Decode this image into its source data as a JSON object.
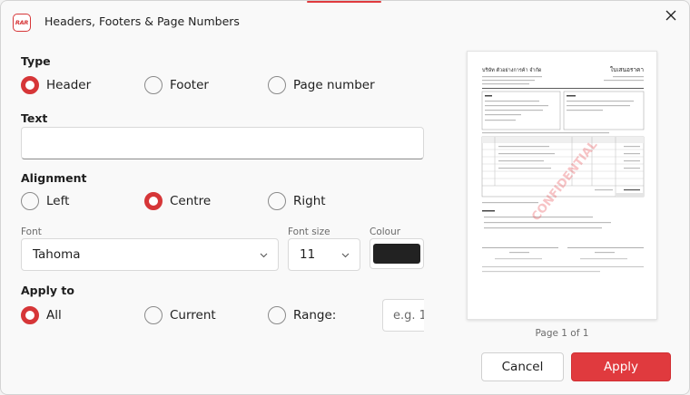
{
  "dialog": {
    "title": "Headers, Footers & Page Numbers",
    "app_icon_text": "RAR",
    "close_icon": "close-icon"
  },
  "type": {
    "label": "Type",
    "options": [
      "Header",
      "Footer",
      "Page number"
    ],
    "selected": "Header"
  },
  "text": {
    "label": "Text",
    "value": ""
  },
  "alignment": {
    "label": "Alignment",
    "options": [
      "Left",
      "Centre",
      "Right"
    ],
    "selected": "Centre"
  },
  "font": {
    "label": "Font",
    "value": "Tahoma"
  },
  "font_size": {
    "label": "Font size",
    "value": "11"
  },
  "colour": {
    "label": "Colour",
    "value": "#222222"
  },
  "apply_to": {
    "label": "Apply to",
    "options": [
      "All",
      "Current",
      "Range:"
    ],
    "selected": "All",
    "range_placeholder": "e.g. 1"
  },
  "preview": {
    "doc_title_left": "บริษัท ตัวอย่างการค้า จำกัด",
    "doc_title_right": "ใบเสนอราคา",
    "watermark": "CONFIDENTIAL",
    "page_count": "Page 1 of 1"
  },
  "buttons": {
    "cancel": "Cancel",
    "apply": "Apply"
  },
  "colors": {
    "accent": "#e03a3e",
    "radio_checked": "#d63638"
  }
}
